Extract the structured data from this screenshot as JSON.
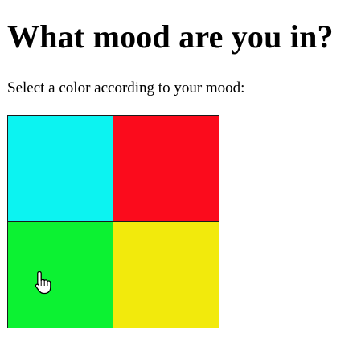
{
  "heading": "What mood are you in?",
  "prompt": "Select a color according to your mood:",
  "swatches": [
    {
      "name": "cyan-swatch",
      "color": "#0cf3f1"
    },
    {
      "name": "red-swatch",
      "color": "#fb0b1c"
    },
    {
      "name": "green-swatch",
      "color": "#0cf232"
    },
    {
      "name": "yellow-swatch",
      "color": "#f2ea0c"
    }
  ],
  "cursor_icon": "hand-pointer-icon"
}
